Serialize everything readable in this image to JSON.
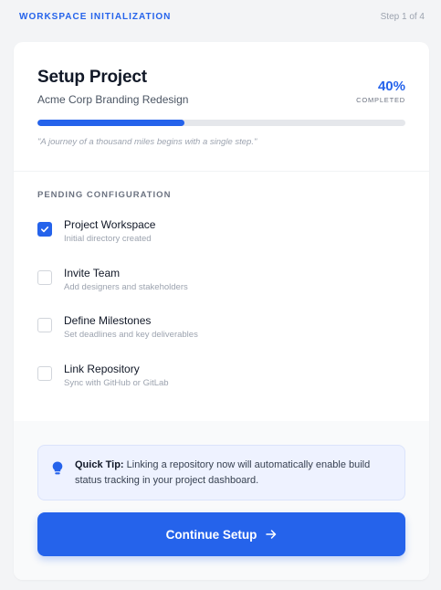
{
  "topbar": {
    "section_label": "WORKSPACE INITIALIZATION",
    "step_label": "Step 1 of 4"
  },
  "project": {
    "title": "Setup Project",
    "subtitle": "Acme Corp Branding Redesign",
    "percent_text": "40%",
    "percent_label": "COMPLETED",
    "progress": 0.4,
    "quote": "\"A journey of a thousand miles begins with a single step.\""
  },
  "pending": {
    "title": "PENDING CONFIGURATION",
    "tasks": [
      {
        "name": "Project Workspace",
        "desc": "Initial directory created",
        "checked": true
      },
      {
        "name": "Invite Team",
        "desc": "Add designers and stakeholders",
        "checked": false
      },
      {
        "name": "Define Milestones",
        "desc": "Set deadlines and key deliverables",
        "checked": false
      },
      {
        "name": "Link Repository",
        "desc": "Sync with GitHub or GitLab",
        "checked": false
      }
    ]
  },
  "tip": {
    "label": "Quick Tip:",
    "text": "Linking a repository now will automatically enable build status tracking in your project dashboard."
  },
  "cta": {
    "label": "Continue Setup"
  },
  "colors": {
    "accent": "#2563eb",
    "track": "#e5e7eb",
    "tip_bg": "#eef2ff"
  },
  "icons": {
    "tip": "lightbulb-icon",
    "cta": "arrow-right-icon",
    "check": "check-icon"
  }
}
